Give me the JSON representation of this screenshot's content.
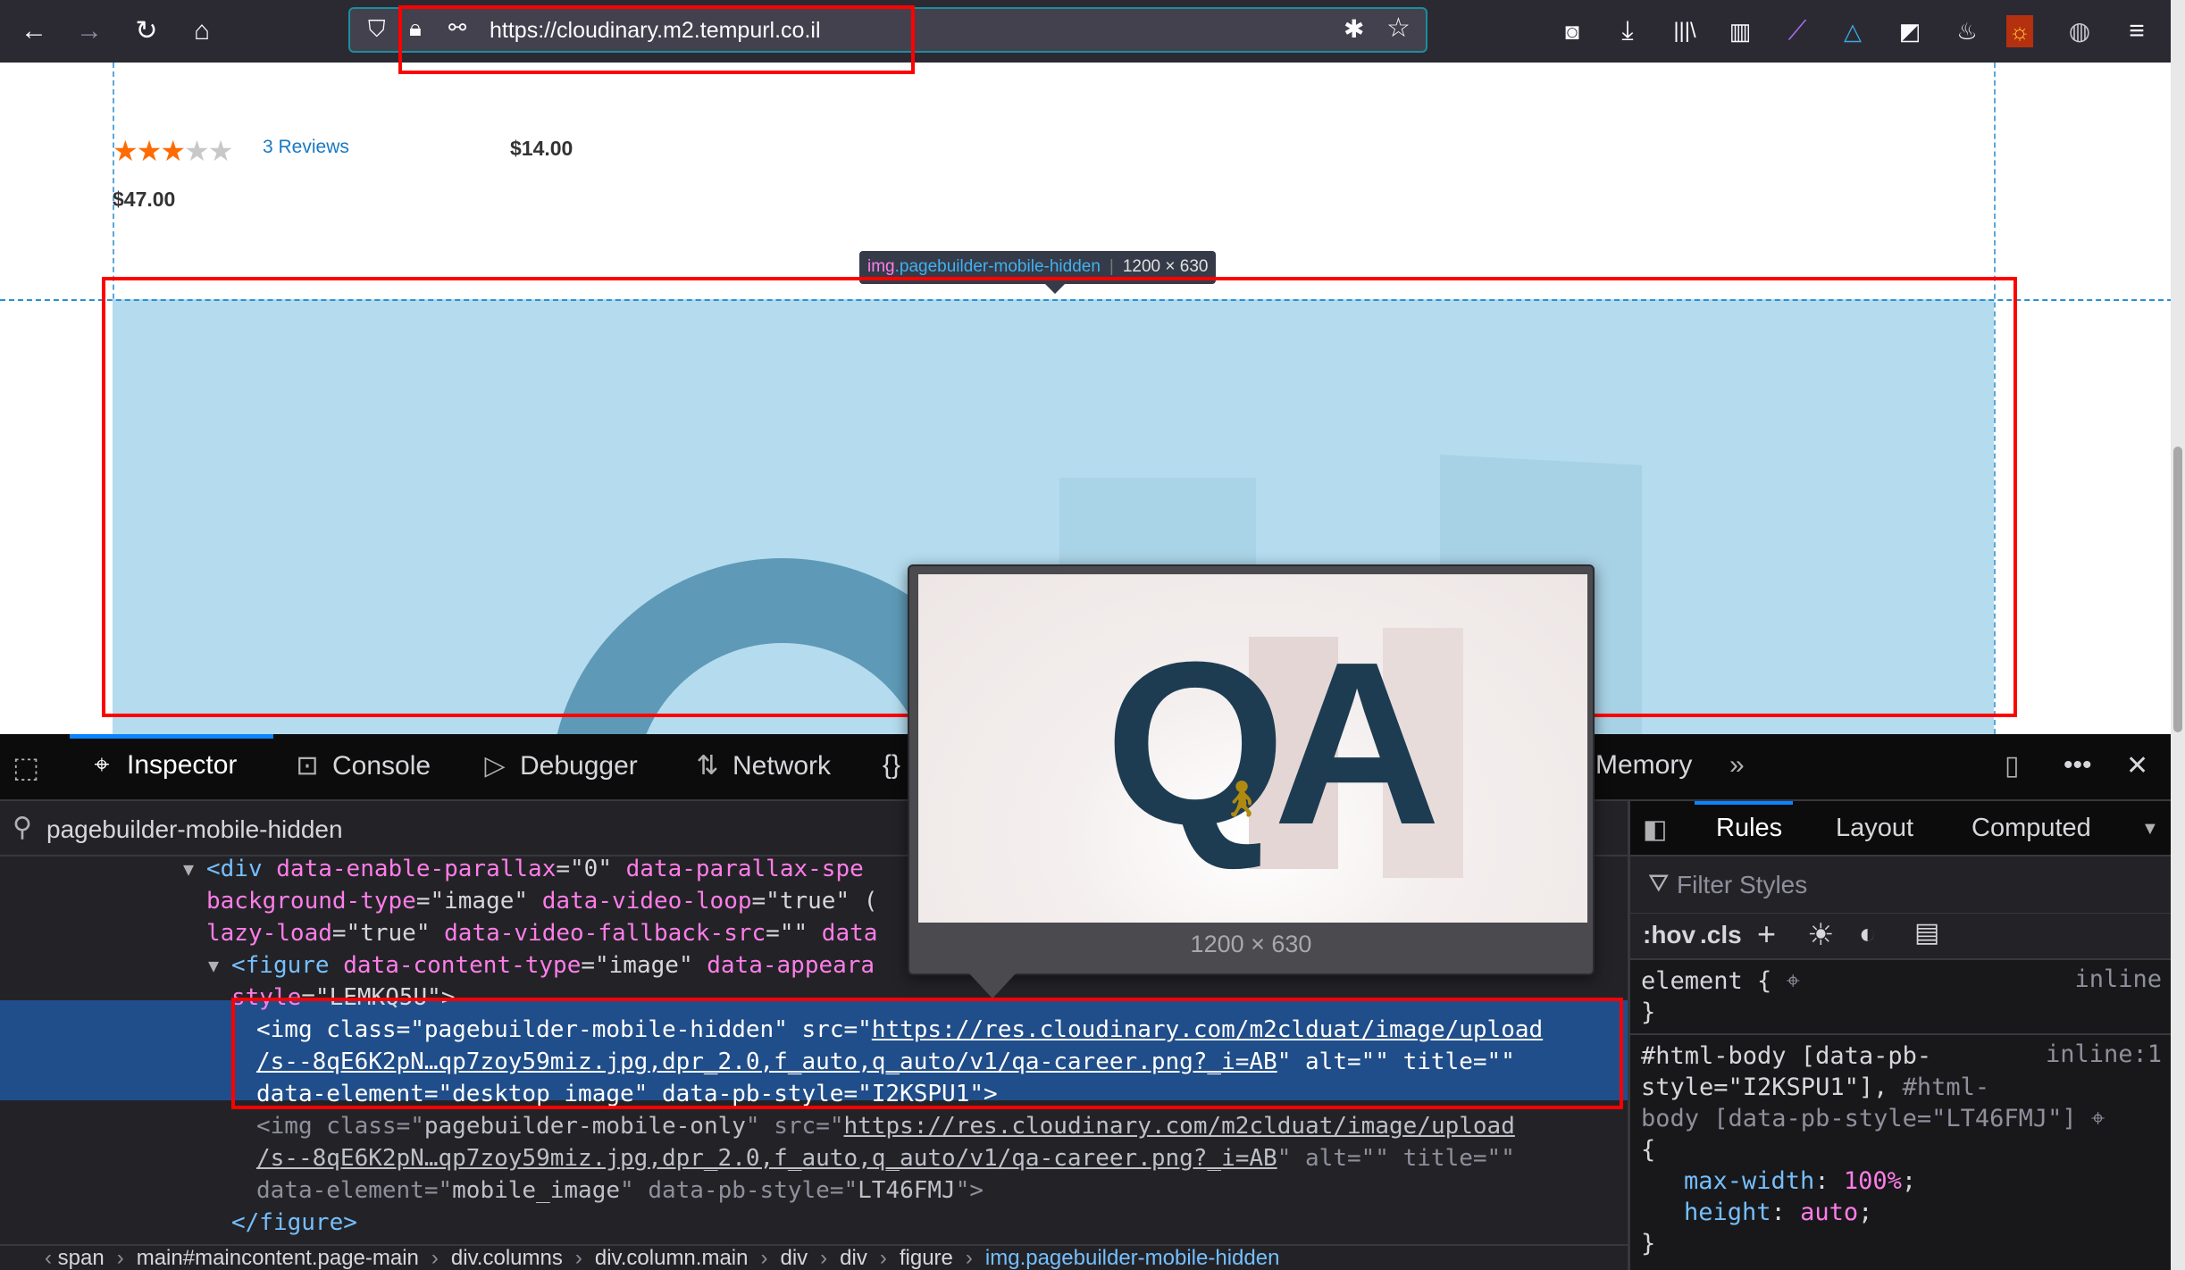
{
  "browser": {
    "url": "https://cloudinary.m2.tempurl.co.il",
    "icons": [
      "back-icon",
      "forward-icon",
      "reload-icon",
      "home-icon",
      "shield-icon",
      "lock-icon",
      "permissions-icon",
      "bug-icon",
      "bookmark-star-icon",
      "pocket-icon",
      "download-icon",
      "library-icon",
      "sidebar-icon",
      "extension-feather-icon",
      "extension-triangle-icon",
      "extension-cube-icon",
      "extension-flame-icon",
      "extension-sun-icon",
      "globe-icon",
      "menu-icon"
    ]
  },
  "page": {
    "rating_stars": 3.5,
    "rating_max": 5,
    "reviews_label": "3 Reviews",
    "price_1": "$14.00",
    "price_2": "$47.00",
    "highlighter": {
      "tag": "img",
      "class": ".pagebuilder-mobile-hidden",
      "size": "1200 × 630"
    }
  },
  "devtools": {
    "tabs": [
      {
        "label": "Inspector",
        "icon": "inspector-icon",
        "active": true
      },
      {
        "label": "Console",
        "icon": "console-icon"
      },
      {
        "label": "Debugger",
        "icon": "debugger-icon"
      },
      {
        "label": "Network",
        "icon": "network-icon"
      },
      {
        "label": "{}",
        "icon": "style-editor-icon"
      },
      {
        "label": "Memory",
        "icon": ""
      }
    ],
    "search_value": "pagebuilder-mobile-hidden",
    "markup_lines": [
      {
        "mode": "",
        "arrow": "▼",
        "segs": [
          [
            "tg",
            "<div "
          ],
          [
            "an",
            "data-enable-parallax"
          ],
          [
            "pu",
            "=\""
          ],
          [
            "av",
            "0"
          ],
          [
            "pu",
            "\" "
          ],
          [
            "an",
            "data-parallax-spe"
          ]
        ]
      },
      {
        "mode": "",
        "segs": [
          [
            "an",
            "background-type"
          ],
          [
            "pu",
            "=\""
          ],
          [
            "av",
            "image"
          ],
          [
            "pu",
            "\" "
          ],
          [
            "an",
            "data-video-loop"
          ],
          [
            "pu",
            "=\""
          ],
          [
            "av",
            "true"
          ],
          [
            "pu",
            "\" ("
          ]
        ]
      },
      {
        "mode": "",
        "segs": [
          [
            "an",
            "lazy-load"
          ],
          [
            "pu",
            "=\""
          ],
          [
            "av",
            "true"
          ],
          [
            "pu",
            "\" "
          ],
          [
            "an",
            "data-video-fallback-src"
          ],
          [
            "pu",
            "=\"\" "
          ],
          [
            "an",
            "data"
          ]
        ]
      },
      {
        "mode": "",
        "arrow": "▼",
        "segs": [
          [
            "tg",
            "<figure "
          ],
          [
            "an",
            "data-content-type"
          ],
          [
            "pu",
            "=\""
          ],
          [
            "av",
            "image"
          ],
          [
            "pu",
            "\" "
          ],
          [
            "an",
            "data-appeara"
          ]
        ]
      },
      {
        "mode": "",
        "segs": [
          [
            "an",
            "style"
          ],
          [
            "pu",
            "=\""
          ],
          [
            "av",
            "LEMKQ5U"
          ],
          [
            "pu",
            "\">"
          ]
        ]
      },
      {
        "mode": "sel",
        "segs": [
          [
            "tg",
            "<img "
          ],
          [
            "an",
            "class"
          ],
          [
            "pu",
            "=\""
          ],
          [
            "av",
            "pagebuilder-mobile-hidden"
          ],
          [
            "pu",
            "\" "
          ],
          [
            "an",
            "src"
          ],
          [
            "pu",
            "=\""
          ],
          [
            "ln",
            "https://res.cloudinary.com/m2clduat/image/upload"
          ]
        ]
      },
      {
        "mode": "sel",
        "segs": [
          [
            "ln",
            "/s--8qE6K2pN…qp7zoy59miz.jpg,dpr_2.0,f_auto,q_auto/v1/qa-career.png?_i=AB"
          ],
          [
            "pu",
            "\" "
          ],
          [
            "an",
            "alt"
          ],
          [
            "pu",
            "=\"\" "
          ],
          [
            "an",
            "title"
          ],
          [
            "pu",
            "=\"\""
          ]
        ]
      },
      {
        "mode": "sel",
        "segs": [
          [
            "an",
            "data-element"
          ],
          [
            "pu",
            "=\""
          ],
          [
            "av",
            "desktop_image"
          ],
          [
            "pu",
            "\" "
          ],
          [
            "an",
            "data-pb-style"
          ],
          [
            "pu",
            "=\""
          ],
          [
            "av",
            "I2KSPU1"
          ],
          [
            "pu",
            "\">"
          ]
        ]
      },
      {
        "mode": "dim",
        "segs": [
          [
            "tg",
            "<img "
          ],
          [
            "an",
            "class"
          ],
          [
            "pu",
            "=\""
          ],
          [
            "av",
            "pagebuilder-mobile-only"
          ],
          [
            "pu",
            "\" "
          ],
          [
            "an",
            "src"
          ],
          [
            "pu",
            "=\""
          ],
          [
            "ln",
            "https://res.cloudinary.com/m2clduat/image/upload"
          ]
        ]
      },
      {
        "mode": "dim",
        "segs": [
          [
            "ln",
            "/s--8qE6K2pN…qp7zoy59miz.jpg,dpr_2.0,f_auto,q_auto/v1/qa-career.png?_i=AB"
          ],
          [
            "pu",
            "\" "
          ],
          [
            "an",
            "alt"
          ],
          [
            "pu",
            "=\"\" "
          ],
          [
            "an",
            "title"
          ],
          [
            "pu",
            "=\"\""
          ]
        ]
      },
      {
        "mode": "dim",
        "segs": [
          [
            "an",
            "data-element"
          ],
          [
            "pu",
            "=\""
          ],
          [
            "av",
            "mobile_image"
          ],
          [
            "pu",
            "\" "
          ],
          [
            "an",
            "data-pb-style"
          ],
          [
            "pu",
            "=\""
          ],
          [
            "av",
            "LT46FMJ"
          ],
          [
            "pu",
            "\">"
          ]
        ]
      },
      {
        "mode": "",
        "segs": [
          [
            "tg",
            "</figure>"
          ]
        ]
      }
    ],
    "breadcrumb": [
      "span",
      "main#maincontent.page-main",
      "div.columns",
      "div.column.main",
      "div",
      "div",
      "figure",
      "img.pagebuilder-mobile-hidden"
    ],
    "preview_size": "1200 × 630",
    "preview_image_text": "QA",
    "rules": {
      "tabs": [
        "Rules",
        "Layout",
        "Computed"
      ],
      "filter_placeholder": "Filter Styles",
      "hov": ":hov",
      "cls": ".cls",
      "element_rule_open": "element {",
      "element_rule_close": "}",
      "element_source": "inline",
      "rule2_selector_1": "#html-body [data-pb-",
      "rule2_selector_2": "style=\"I2KSPU1\"],",
      "rule2_selector_2b": " #html-",
      "rule2_selector_3": "body [data-pb-style=\"LT46FMJ\"]",
      "rule2_open": "{",
      "rule2_source": "inline:1",
      "decls": [
        {
          "prop": "max-width",
          "value": "100%"
        },
        {
          "prop": "height",
          "value": "auto"
        }
      ],
      "rule2_close": "}"
    }
  },
  "colors": {
    "accent": "#0a84ff",
    "highlight_box": "#ff0000",
    "selected_row": "#204e8a",
    "star": "#ff6b00",
    "link": "#1979c3"
  }
}
